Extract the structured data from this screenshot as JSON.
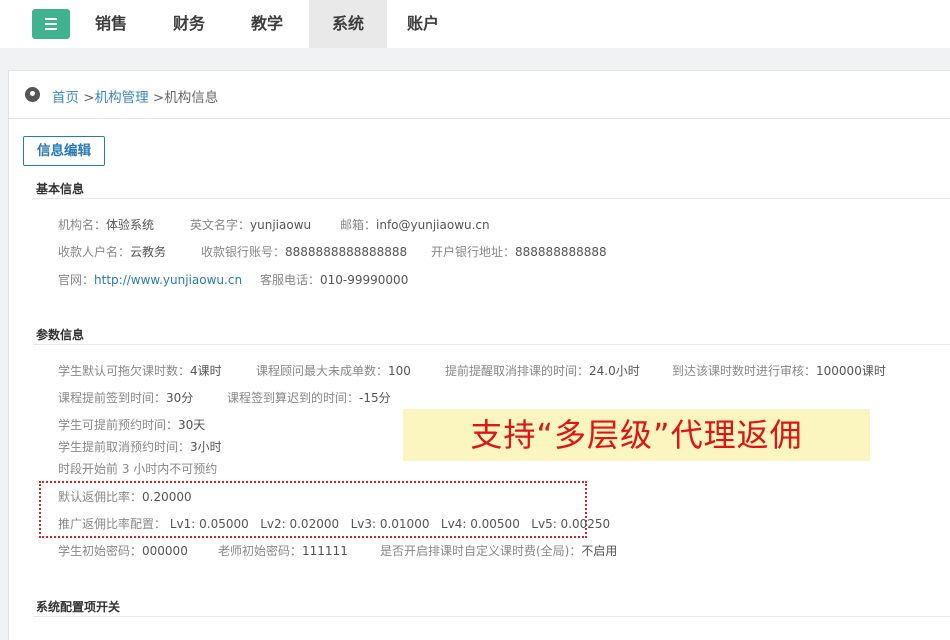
{
  "nav": {
    "tabs": [
      {
        "label": "销售"
      },
      {
        "label": "财务"
      },
      {
        "label": "教学"
      },
      {
        "label": "系统"
      },
      {
        "label": "账户"
      }
    ],
    "active_tab": "系统"
  },
  "breadcrumb": {
    "home": "首页",
    "sep1": ">",
    "mid": "机构管理",
    "sep2": ">",
    "current": "机构信息"
  },
  "edit_button": "信息编辑",
  "basic": {
    "title": "基本信息",
    "org_name_label": "机构名：",
    "org_name": "体验系统",
    "en_name_label": "英文名字：",
    "en_name": "yunjiaowu",
    "email_label": "邮箱：",
    "email": "info@yunjiaowu.cn",
    "payee_label": "收款人户名：",
    "payee": "云教务",
    "account_label": "收款银行账号：",
    "account": "8888888888888888",
    "bank_label": "开户银行地址：",
    "bank": "888888888888",
    "site_label": "官网：",
    "site": "http://www.yunjiaowu.cn",
    "phone_label": "客服电话：",
    "phone": "010-99990000"
  },
  "params": {
    "title": "参数信息",
    "owe_label": "学生默认可拖欠课时数：",
    "owe": "4课时",
    "consultant_label": "课程顾问最大未成单数：",
    "consultant": "100",
    "remind_label": "提前提醒取消排课的时间：",
    "remind": "24.0小时",
    "audit_label": "到达该课时数时进行审核：",
    "audit": "100000课时",
    "signin_label": "课程提前签到时间：",
    "signin": "30分",
    "late_label": "课程签到算迟到的时间：",
    "late": "-15分",
    "book_label": "学生可提前预约时间：",
    "book": "30天",
    "cancel_label": "学生提前取消预约时间：",
    "cancel": "3小时",
    "noreserve": "时段开始前 3 小时内不可预约",
    "rebate_label": "默认返佣比率：",
    "rebate": "0.20000",
    "promo_label": "推广返佣比率配置：",
    "levels": [
      "Lv1: 0.05000",
      "Lv2: 0.02000",
      "Lv3: 0.01000",
      "Lv4: 0.00500",
      "Lv5: 0.00250"
    ],
    "stu_pwd_label": "学生初始密码：",
    "stu_pwd": "000000",
    "tea_pwd_label": "老师初始密码：",
    "tea_pwd": "111111",
    "custom_fee_label": "是否开启排课时自定义课时费(全局)：",
    "custom_fee": "不启用"
  },
  "promo_banner": "支持“多层级”代理返佣",
  "config": {
    "title": "系统配置项开关"
  }
}
